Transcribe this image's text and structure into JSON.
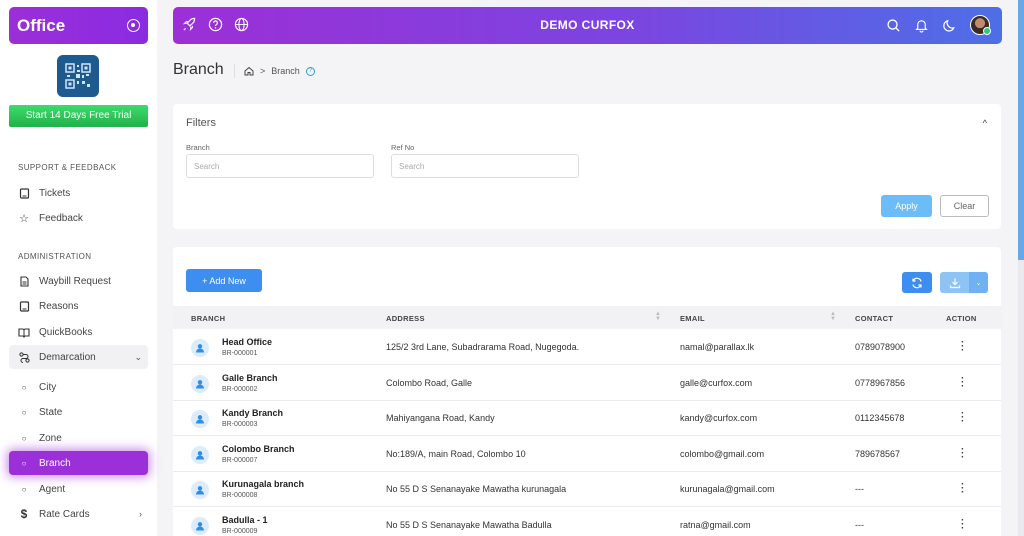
{
  "sidebar": {
    "brand": "Office",
    "trial_label": "Start 14 Days Free Trial",
    "sections": [
      {
        "heading": "SUPPORT & FEEDBACK",
        "items": [
          "Tickets",
          "Feedback"
        ]
      },
      {
        "heading": "ADMINISTRATION",
        "items": [
          "Waybill Request",
          "Reasons",
          "QuickBooks",
          "Demarcation"
        ]
      }
    ],
    "demarcation_children": [
      "City",
      "State",
      "Zone",
      "Branch",
      "Agent"
    ],
    "rate_cards": "Rate Cards",
    "active_item": "Branch"
  },
  "topbar": {
    "title": "DEMO CURFOX",
    "left_icons": [
      "rocket-icon",
      "help-icon",
      "globe-icon"
    ],
    "right_icons": [
      "search-icon",
      "bell-icon",
      "moon-icon",
      "avatar"
    ]
  },
  "page": {
    "title": "Branch",
    "breadcrumb": "Branch"
  },
  "filters": {
    "title": "Filters",
    "branch_label": "Branch",
    "branch_placeholder": "Search",
    "ref_label": "Ref No",
    "ref_placeholder": "Search",
    "apply": "Apply",
    "clear": "Clear"
  },
  "table": {
    "add_new": "+ Add New",
    "columns": [
      "BRANCH",
      "ADDRESS",
      "EMAIL",
      "CONTACT",
      "ACTION"
    ],
    "rows": [
      {
        "name": "Head Office",
        "code": "BR-000001",
        "address": "125/2 3rd Lane, Subadrarama Road, Nugegoda.",
        "email": "namal@parallax.lk",
        "contact": "0789078900"
      },
      {
        "name": "Galle Branch",
        "code": "BR-000002",
        "address": "Colombo Road, Galle",
        "email": "galle@curfox.com",
        "contact": "0778967856"
      },
      {
        "name": "Kandy Branch",
        "code": "BR-000003",
        "address": "Mahiyangana Road, Kandy",
        "email": "kandy@curfox.com",
        "contact": "0112345678"
      },
      {
        "name": "Colombo Branch",
        "code": "BR-000007",
        "address": "No:189/A, main Road, Colombo 10",
        "email": "colombo@gmail.com",
        "contact": "789678567"
      },
      {
        "name": "Kurunagala branch",
        "code": "BR-000008",
        "address": "No 55 D S Senanayake Mawatha kurunagala",
        "email": "kurunagala@gmail.com",
        "contact": "---"
      },
      {
        "name": "Badulla - 1",
        "code": "BR-000009",
        "address": "No 55 D S Senanayake Mawatha Badulla",
        "email": "ratna@gmail.com",
        "contact": "---"
      }
    ]
  }
}
